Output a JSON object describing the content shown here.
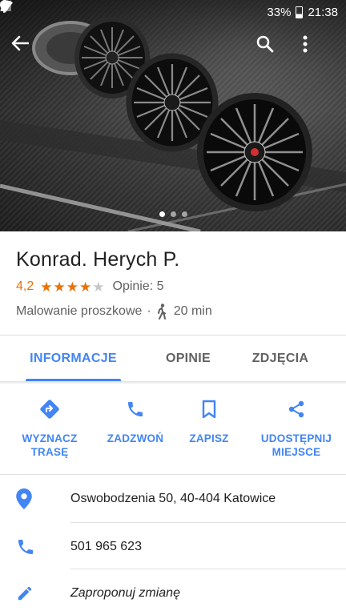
{
  "status_bar": {
    "battery": "33%",
    "time": "21:38",
    "icons": [
      "location-icon",
      "bluetooth-icon",
      "wifi-icon",
      "signal-icon",
      "battery-icon"
    ]
  },
  "hero": {
    "description_icon": "photo",
    "page_count": 3,
    "active_page": 1
  },
  "toolbar": {
    "back_icon": "back-arrow-icon",
    "search_icon": "search-icon",
    "menu_icon": "more-vert-icon"
  },
  "place": {
    "name": "Konrad. Herych P.",
    "rating": "4,2",
    "rating_value": 4.2,
    "stars_filled": 4,
    "stars_total": 5,
    "reviews": "Opinie: 5",
    "category": "Malowanie proszkowe",
    "separator": "·",
    "walk_time": "20 min"
  },
  "tabs": [
    {
      "label": "INFORMACJE",
      "active": true
    },
    {
      "label": "OPINIE",
      "active": false
    },
    {
      "label": "ZDJĘCIA",
      "active": false
    }
  ],
  "actions": [
    {
      "label": "WYZNACZ\nTRASĘ",
      "icon": "directions-icon"
    },
    {
      "label": "ZADZWOŃ",
      "icon": "phone-icon"
    },
    {
      "label": "ZAPISZ",
      "icon": "bookmark-icon"
    },
    {
      "label": "UDOSTĘPNIJ\nMIEJSCE",
      "icon": "share-icon"
    }
  ],
  "info": {
    "address": "Oswobodzenia 50, 40-404 Katowice",
    "phone": "501 965 623",
    "suggest_edit": "Zaproponuj zmianę"
  },
  "colors": {
    "accent": "#4285f4",
    "rating": "#e8710a",
    "text_primary": "#212121",
    "text_secondary": "#616161"
  }
}
